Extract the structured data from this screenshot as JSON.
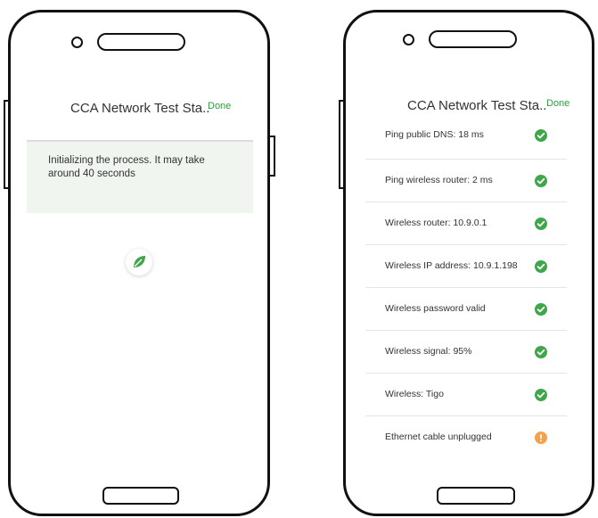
{
  "left_screen": {
    "title": "CCA Network Test Sta..",
    "done_label": "Done",
    "status_message": "Initializing the process. It may take around 40 seconds",
    "loading_icon": "leaf-icon"
  },
  "right_screen": {
    "title": "CCA Network Test Sta..",
    "done_label": "Done",
    "results": [
      {
        "label": "Ping public DNS: 18 ms",
        "status": "ok"
      },
      {
        "label": "Ping wireless router: 2 ms",
        "status": "ok"
      },
      {
        "label": "Wireless router: 10.9.0.1",
        "status": "ok"
      },
      {
        "label": "Wireless IP address: 10.9.1.198",
        "status": "ok"
      },
      {
        "label": "Wireless password valid",
        "status": "ok"
      },
      {
        "label": "Wireless signal: 95%",
        "status": "ok"
      },
      {
        "label": "Wireless: Tigo",
        "status": "ok"
      },
      {
        "label": "Ethernet cable unplugged",
        "status": "warning"
      }
    ]
  },
  "colors": {
    "accent": "#2e9e3a",
    "ok": "#3fa64a",
    "warning": "#f3a14b",
    "status_bg": "#f1f5f0"
  }
}
